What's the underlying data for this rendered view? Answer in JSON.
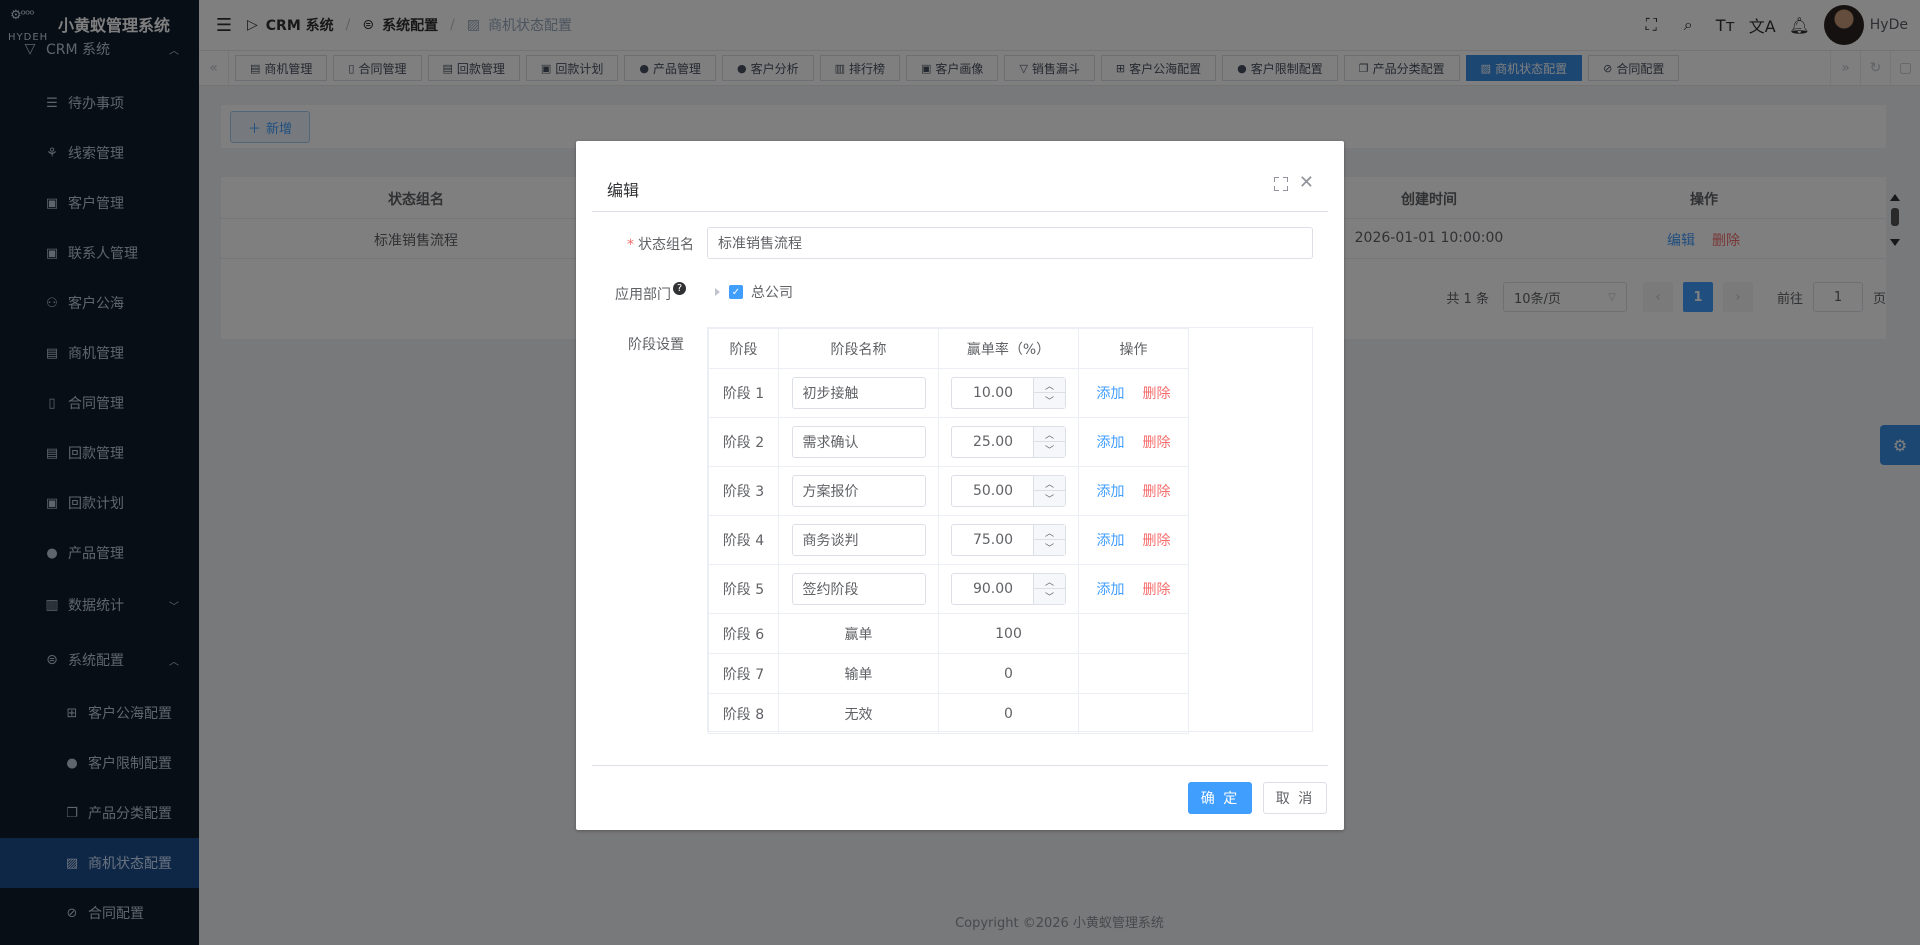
{
  "brand": {
    "name": "小黄蚁管理系统",
    "logo_text": "HYDEH"
  },
  "sidebar": {
    "top_group": "CRM 系统",
    "items": [
      {
        "label": "待办事项",
        "icon": "list-icon"
      },
      {
        "label": "线索管理",
        "icon": "clue-icon"
      },
      {
        "label": "客户管理",
        "icon": "customer-icon"
      },
      {
        "label": "联系人管理",
        "icon": "contact-icon"
      },
      {
        "label": "客户公海",
        "icon": "pool-icon"
      },
      {
        "label": "商机管理",
        "icon": "bus-icon"
      },
      {
        "label": "合同管理",
        "icon": "contract-icon"
      },
      {
        "label": "回款管理",
        "icon": "payment-icon"
      },
      {
        "label": "回款计划",
        "icon": "plan-icon"
      },
      {
        "label": "产品管理",
        "icon": "product-icon"
      }
    ],
    "stats_group": "数据统计",
    "config_group": "系统配置",
    "sub_items": [
      {
        "label": "客户公海配置"
      },
      {
        "label": "客户限制配置"
      },
      {
        "label": "产品分类配置"
      },
      {
        "label": "商机状态配置"
      },
      {
        "label": "合同配置"
      }
    ]
  },
  "header": {
    "breadcrumb": [
      "CRM 系统",
      "系统配置",
      "商机状态配置"
    ],
    "user": "HyDe"
  },
  "tags": [
    "商机管理",
    "合同管理",
    "回款管理",
    "回款计划",
    "产品管理",
    "客户分析",
    "排行榜",
    "客户画像",
    "销售漏斗",
    "客户公海配置",
    "客户限制配置",
    "产品分类配置",
    "商机状态配置",
    "合同配置"
  ],
  "page": {
    "add_button": "新增",
    "table": {
      "col_name": "状态组名",
      "col_created": "创建时间",
      "col_ops": "操作",
      "row": {
        "name": "标准销售流程",
        "created": "2026-01-01 10:00:00",
        "edit": "编辑",
        "delete": "删除"
      }
    },
    "pager": {
      "total": "共 1 条",
      "size": "10条/页",
      "current": "1",
      "goto_label": "前往",
      "goto_value": "1",
      "goto_unit": "页"
    },
    "footer": "Copyright ©2026 小黄蚁管理系统"
  },
  "dialog": {
    "title": "编辑",
    "label_name": "状态组名",
    "name_value": "标准销售流程",
    "label_dept": "应用部门",
    "dept_node": "总公司",
    "label_stages": "阶段设置",
    "table_headers": [
      "阶段",
      "阶段名称",
      "赢单率（%）",
      "操作"
    ],
    "editable_stages": [
      {
        "stage": "阶段 1",
        "name": "初步接触",
        "rate": "10.00"
      },
      {
        "stage": "阶段 2",
        "name": "需求确认",
        "rate": "25.00"
      },
      {
        "stage": "阶段 3",
        "name": "方案报价",
        "rate": "50.00"
      },
      {
        "stage": "阶段 4",
        "name": "商务谈判",
        "rate": "75.00"
      },
      {
        "stage": "阶段 5",
        "name": "签约阶段",
        "rate": "90.00"
      }
    ],
    "fixed_stages": [
      {
        "stage": "阶段 6",
        "name": "赢单",
        "rate": "100"
      },
      {
        "stage": "阶段 7",
        "name": "输单",
        "rate": "0"
      },
      {
        "stage": "阶段 8",
        "name": "无效",
        "rate": "0"
      }
    ],
    "op_add": "添加",
    "op_delete": "删除",
    "ok": "确 定",
    "cancel": "取 消"
  }
}
